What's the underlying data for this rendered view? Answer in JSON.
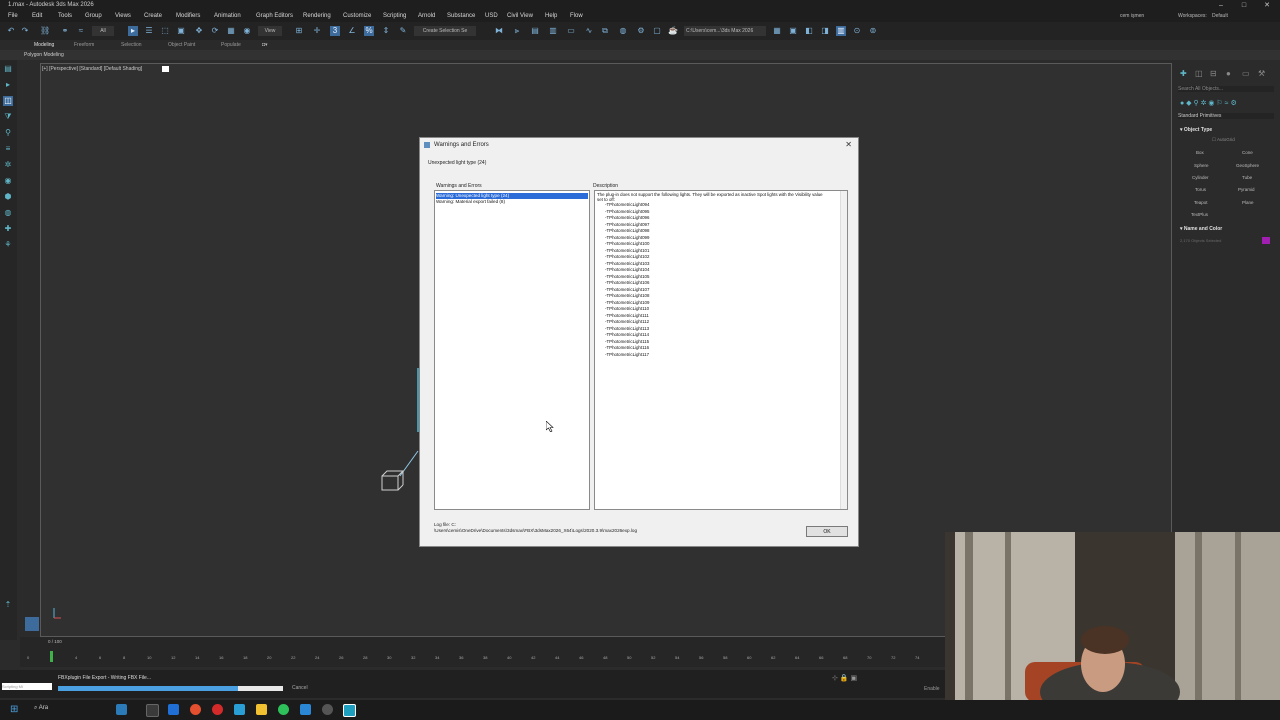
{
  "window": {
    "title": "1.max - Autodesk 3ds Max 2026",
    "controls": [
      "–",
      "□",
      "✕"
    ]
  },
  "menubar": {
    "items": [
      "File",
      "Edit",
      "Tools",
      "Group",
      "Views",
      "Create",
      "Modifiers",
      "Animation",
      "Graph Editors",
      "Rendering",
      "Customize",
      "Scripting",
      "Arnold",
      "Substance",
      "USD",
      "Civil View",
      "Help",
      "Flow"
    ],
    "user": "cem işmen",
    "workspaces_label": "Workspaces:",
    "workspace": "Default"
  },
  "toolbar": {
    "selection_filter": "All",
    "view_dropdown": "View",
    "named_selection": "Create Selection Se",
    "path": "C:\\Users\\cem...\\3ds Max 2026"
  },
  "ribbon": {
    "tabs": [
      "Modeling",
      "Freeform",
      "Selection",
      "Object Paint",
      "Populate"
    ],
    "active": "Modeling",
    "sub": "Polygon Modeling"
  },
  "viewport": {
    "label": "[+] [Perspective] [Standard] [Default Shading]"
  },
  "command_panel": {
    "search_placeholder": "Search All Objects...",
    "category": "Standard Primitives",
    "rollout_object_type": "Object Type",
    "autogrid": "AutoGrid",
    "primitives": [
      "Box",
      "Cone",
      "Sphere",
      "GeoSphere",
      "Cylinder",
      "Tube",
      "Torus",
      "Pyramid",
      "Teapot",
      "Plane",
      "TextPlus"
    ],
    "rollout_name_color": "Name and Color",
    "object_count": "2,170 Objects Selected",
    "color_swatch": "#a11fb0"
  },
  "dialog": {
    "title": "Warnings and Errors",
    "subtitle": "Unexpected light type (24)",
    "list_header": "Warnings and Errors",
    "desc_header": "Description",
    "items": [
      "Warning: Unexpected light type (24)",
      "Warning: Material export failed (8)"
    ],
    "selected_index": 0,
    "description": "The plug-in does not support the following lights. They will be exported as inactive Spot lights with the Visibility value set to off:",
    "lights": [
      "-TPhotometricLight094",
      "-TPhotometricLight095",
      "-TPhotometricLight096",
      "-TPhotometricLight097",
      "-TPhotometricLight098",
      "-TPhotometricLight099",
      "-TPhotometricLight100",
      "-TPhotometricLight101",
      "-TPhotometricLight102",
      "-TPhotometricLight103",
      "-TPhotometricLight104",
      "-TPhotometricLight105",
      "-TPhotometricLight106",
      "-TPhotometricLight107",
      "-TPhotometricLight108",
      "-TPhotometricLight109",
      "-TPhotometricLight110",
      "-TPhotometricLight111",
      "-TPhotometricLight112",
      "-TPhotometricLight113",
      "-TPhotometricLight114",
      "-TPhotometricLight115",
      "-TPhotometricLight116",
      "-TPhotometricLight117"
    ],
    "log_label": "Log file: C:",
    "log_path": "\\Users\\cemis\\OneDrive\\Documents\\3dsmax\\FBX\\3dsMax2026_X64\\Logs\\2020.3.9\\max2026exp.log",
    "ok": "OK"
  },
  "timeline": {
    "frame_counter": "0 / 100",
    "ticks": [
      "0",
      "2",
      "4",
      "6",
      "8",
      "10",
      "12",
      "14",
      "16",
      "18",
      "20",
      "22",
      "24",
      "26",
      "28",
      "30",
      "32",
      "34",
      "36",
      "38",
      "40",
      "42",
      "44",
      "46",
      "48",
      "50",
      "52",
      "54",
      "56",
      "58",
      "60",
      "62",
      "64",
      "66",
      "68",
      "70",
      "72",
      "74"
    ]
  },
  "status": {
    "script_field": "Scripting Mi",
    "task": "FBXplugin File Export - Writing FBX File...",
    "progress": 0.8,
    "cancel": "Cancel",
    "enable_label": "Enable"
  },
  "taskbar": {
    "search": "Ara"
  }
}
